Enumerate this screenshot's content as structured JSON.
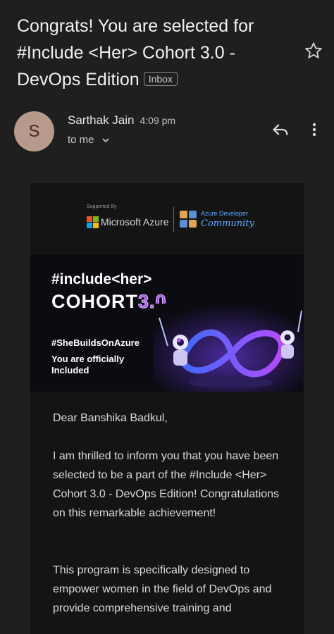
{
  "email": {
    "subject": "Congrats! You are selected for #Include <Her> Cohort 3.0 -DevOps Edition",
    "label": "Inbox",
    "sender_name": "Sarthak Jain",
    "time": "4:09 pm",
    "recipient": "to me",
    "avatar_letter": "S"
  },
  "sponsor": {
    "supported_by": "Supported By",
    "microsoft": "Microsoft Azure",
    "community_title": "Azure Developer",
    "community_sub": "Community"
  },
  "banner": {
    "line1": "#include<her>",
    "cohort": "COHORT",
    "cohort_num": "3.0",
    "hashtag": "#SheBuildsOnAzure",
    "officially1": "You are officially",
    "officially2": "Included"
  },
  "body": {
    "greeting": "Dear Banshika Badkul,",
    "para1": "I am thrilled to inform you that you have been selected to be a part of the #Include <Her> Cohort 3.0 - DevOps Edition! Congratulations on this remarkable achievement!",
    "para2": "This program is specifically designed to empower women in the field of DevOps and provide comprehensive training and"
  },
  "icons": [
    "star-icon",
    "reply-icon",
    "more-vert-icon",
    "chevron-down-icon"
  ],
  "colors": {
    "background": "#1f1f1f",
    "card": "#141414",
    "accent_purple": "#a34ef5",
    "azure_blue": "#5fa8ff"
  }
}
